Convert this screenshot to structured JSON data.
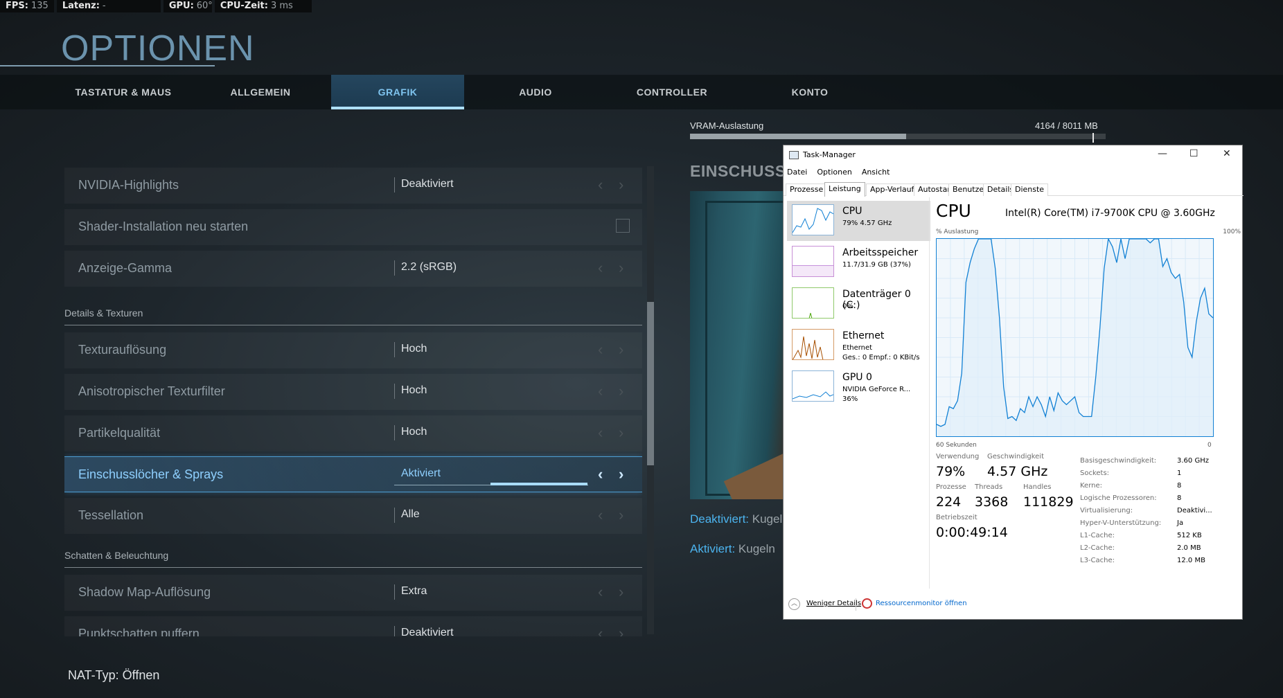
{
  "hud": [
    {
      "label": "FPS:",
      "value": "135"
    },
    {
      "label": "Latenz:",
      "value": "-"
    },
    {
      "label": "GPU:",
      "value": "60°"
    },
    {
      "label": "CPU-Zeit:",
      "value": "3 ms"
    }
  ],
  "page_title": "OPTIONEN",
  "tabs": [
    {
      "label": "TASTATUR & MAUS"
    },
    {
      "label": "ALLGEMEIN"
    },
    {
      "label": "GRAFIK",
      "active": true
    },
    {
      "label": "AUDIO"
    },
    {
      "label": "CONTROLLER"
    },
    {
      "label": "KONTO"
    }
  ],
  "vram": {
    "label": "VRAM-Auslastung",
    "value": "4164 / 8011 MB",
    "used_fraction": 0.52,
    "limit_fraction": 0.978
  },
  "settings": {
    "rows": [
      {
        "label": "NVIDIA-Highlights",
        "value": "Deaktiviert"
      },
      {
        "label": "Shader-Installation neu starten",
        "value": ""
      },
      {
        "label": "Anzeige-Gamma",
        "value": "2.2 (sRGB)"
      }
    ],
    "section1": "Details & Texturen",
    "rows2": [
      {
        "label": "Texturauflösung",
        "value": "Hoch"
      },
      {
        "label": "Anisotropischer Texturfilter",
        "value": "Hoch"
      },
      {
        "label": "Partikelqualität",
        "value": "Hoch"
      },
      {
        "label": "Einschusslöcher & Sprays",
        "value": "Aktiviert",
        "selected": true
      },
      {
        "label": "Tessellation",
        "value": "Alle"
      }
    ],
    "section2": "Schatten & Beleuchtung",
    "rows3": [
      {
        "label": "Shadow Map-Auflösung",
        "value": "Extra"
      },
      {
        "label": "Punktschatten puffern",
        "value": "Deaktiviert"
      }
    ]
  },
  "arrows": {
    "left": "‹",
    "right": "›"
  },
  "detail": {
    "heading": "EINSCHUSSLÖCHER & SPRAYS",
    "line1_key": "Deaktiviert:",
    "line1_text": " Kugeln",
    "line2_key": "Aktiviert:",
    "line2_text": " Kugeln"
  },
  "nat": "NAT-Typ: Öffnen",
  "task_manager": {
    "title": "Task-Manager",
    "window_buttons": [
      "—",
      "☐",
      "✕"
    ],
    "menu": [
      "Datei",
      "Optionen",
      "Ansicht"
    ],
    "tabs": [
      "Prozesse",
      "Leistung",
      "App-Verlauf",
      "Autostart",
      "Benutzer",
      "Details",
      "Dienste"
    ],
    "active_tab": "Leistung",
    "side": [
      {
        "name": "CPU",
        "sub1": "79% 4.57 GHz",
        "sub2": "",
        "color": "#1180d4"
      },
      {
        "name": "Arbeitsspeicher",
        "sub1": "11.7/31.9 GB (37%)",
        "sub2": "",
        "color": "#8b22b8"
      },
      {
        "name": "Datenträger 0 (C:)",
        "sub1": "0%",
        "sub2": "",
        "color": "#4da60c"
      },
      {
        "name": "Ethernet",
        "sub1": "Ethernet",
        "sub2": "Ges.: 0 Empf.: 0 KBit/s",
        "color": "#a74f01"
      },
      {
        "name": "GPU 0",
        "sub1": "NVIDIA GeForce R...",
        "sub2": "36%",
        "color": "#1180d4"
      }
    ],
    "cpu_title": "CPU",
    "cpu_model": "Intel(R) Core(TM) i7-9700K CPU @ 3.60GHz",
    "axis_top_left": "% Auslastung",
    "axis_top_right": "100%",
    "axis_bottom_left": "60 Sekunden",
    "axis_bottom_right": "0",
    "chart_data": {
      "type": "line",
      "title": "CPU",
      "xlabel": "60 Sekunden",
      "ylabel": "% Auslastung",
      "ylim": [
        0,
        100
      ],
      "xlim": [
        60,
        0
      ],
      "series": [
        {
          "values": [
            6,
            5,
            6,
            15,
            14,
            18,
            32,
            78,
            88,
            95,
            100,
            100,
            100,
            100,
            85,
            60,
            25,
            9,
            10,
            8,
            14,
            12,
            20,
            15,
            20,
            16,
            10,
            20,
            13,
            22,
            18,
            16,
            18,
            20,
            12,
            10,
            10,
            10,
            30,
            55,
            85,
            100,
            96,
            88,
            100,
            90,
            100,
            100,
            100,
            100,
            100,
            98,
            100,
            100,
            86,
            90,
            83,
            80,
            82,
            68,
            45,
            40,
            58,
            70,
            75,
            62,
            60
          ]
        }
      ]
    },
    "stats": {
      "k_use": "Verwendung",
      "v_use": "79%",
      "k_speed": "Geschwindigkeit",
      "v_speed": "4.57 GHz",
      "k_proc": "Prozesse",
      "v_proc": "224",
      "k_thr": "Threads",
      "v_thr": "3368",
      "k_hnd": "Handles",
      "v_hnd": "111829",
      "k_up": "Betriebszeit",
      "v_up": "0:00:49:14"
    },
    "specs": [
      {
        "k": "Basisgeschwindigkeit:",
        "v": "3.60 GHz"
      },
      {
        "k": "Sockets:",
        "v": "1"
      },
      {
        "k": "Kerne:",
        "v": "8"
      },
      {
        "k": "Logische Prozessoren:",
        "v": "8"
      },
      {
        "k": "Virtualisierung:",
        "v": "Deaktivi..."
      },
      {
        "k": "Hyper-V-Unterstützung:",
        "v": "Ja"
      },
      {
        "k": "L1-Cache:",
        "v": "512 KB"
      },
      {
        "k": "L2-Cache:",
        "v": "2.0 MB"
      },
      {
        "k": "L3-Cache:",
        "v": "12.0 MB"
      }
    ],
    "footer": {
      "less": "Weniger Details",
      "resmon": "Ressourcenmonitor öffnen"
    }
  }
}
